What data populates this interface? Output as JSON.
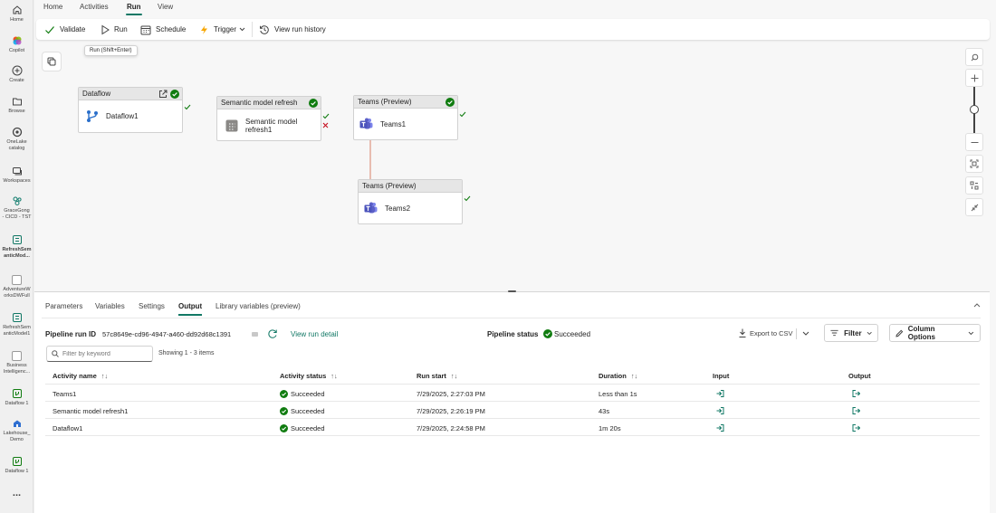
{
  "rail": {
    "items": [
      {
        "label": "Home",
        "icon": "home-icon"
      },
      {
        "label": "Copilot",
        "icon": "copilot-icon"
      },
      {
        "label": "Create",
        "icon": "create-icon"
      },
      {
        "label": "Browse",
        "icon": "browse-icon"
      },
      {
        "label": "OneLake\ncatalog",
        "icon": "onelake-icon"
      },
      {
        "label": "Workspaces",
        "icon": "workspaces-icon"
      },
      {
        "label": "GraceGong\n- CICD - TST",
        "icon": "workspace-icon"
      },
      {
        "label": "RefreshSem\nanticMod...",
        "icon": "pipeline-icon"
      },
      {
        "label": "AdventureW\norksDWFull",
        "icon": "app-icon"
      },
      {
        "label": "RefreshSem\nanticModel1",
        "icon": "pipeline-icon"
      },
      {
        "label": "Business\nIntelligenc...",
        "icon": "app-icon"
      },
      {
        "label": "Dataflow 1",
        "icon": "dataflow-icon"
      },
      {
        "label": "Lakehouse_\nDemo",
        "icon": "lakehouse-icon"
      },
      {
        "label": "Dataflow 1",
        "icon": "dataflow-icon"
      }
    ],
    "more": "..."
  },
  "tabs": [
    "Home",
    "Activities",
    "Run",
    "View"
  ],
  "toolbar": {
    "validate": "Validate",
    "run": "Run",
    "schedule": "Schedule",
    "trigger": "Trigger",
    "view_history": "View run history"
  },
  "tooltip": "Run (Shift+Enter)",
  "nodes": {
    "dataflow": {
      "header": "Dataflow",
      "name": "Dataflow1"
    },
    "semantic": {
      "header": "Semantic model refresh",
      "name": "Semantic model refresh1"
    },
    "teams1": {
      "header": "Teams (Preview)",
      "name": "Teams1"
    },
    "teams2": {
      "header": "Teams (Preview)",
      "name": "Teams2"
    }
  },
  "panel": {
    "tabs": [
      "Parameters",
      "Variables",
      "Settings",
      "Output",
      "Library variables (preview)"
    ],
    "active_tab": "Output",
    "run_id_label": "Pipeline run ID",
    "run_id": "57c8649e-cd96-4947-a460-dd92d68c1391",
    "view_detail": "View run detail",
    "status_label": "Pipeline status",
    "status_value": "Succeeded",
    "export": "Export to CSV",
    "filter_btn": "Filter",
    "column_options": "Column Options",
    "filter_placeholder": "Filter by keyword",
    "showing": "Showing 1 - 3 items"
  },
  "table": {
    "headers": {
      "name": "Activity name",
      "status": "Activity status",
      "start": "Run start",
      "duration": "Duration",
      "input": "Input",
      "output": "Output"
    },
    "rows": [
      {
        "name": "Teams1",
        "status": "Succeeded",
        "start": "7/29/2025, 2:27:03 PM",
        "duration": "Less than 1s"
      },
      {
        "name": "Semantic model refresh1",
        "status": "Succeeded",
        "start": "7/29/2025, 2:26:19 PM",
        "duration": "43s"
      },
      {
        "name": "Dataflow1",
        "status": "Succeeded",
        "start": "7/29/2025, 2:24:58 PM",
        "duration": "1m 20s"
      }
    ]
  },
  "colors": {
    "accent": "#117865",
    "success": "#107c10",
    "fail": "#c50f1f",
    "teams": "#5b5fc7"
  }
}
